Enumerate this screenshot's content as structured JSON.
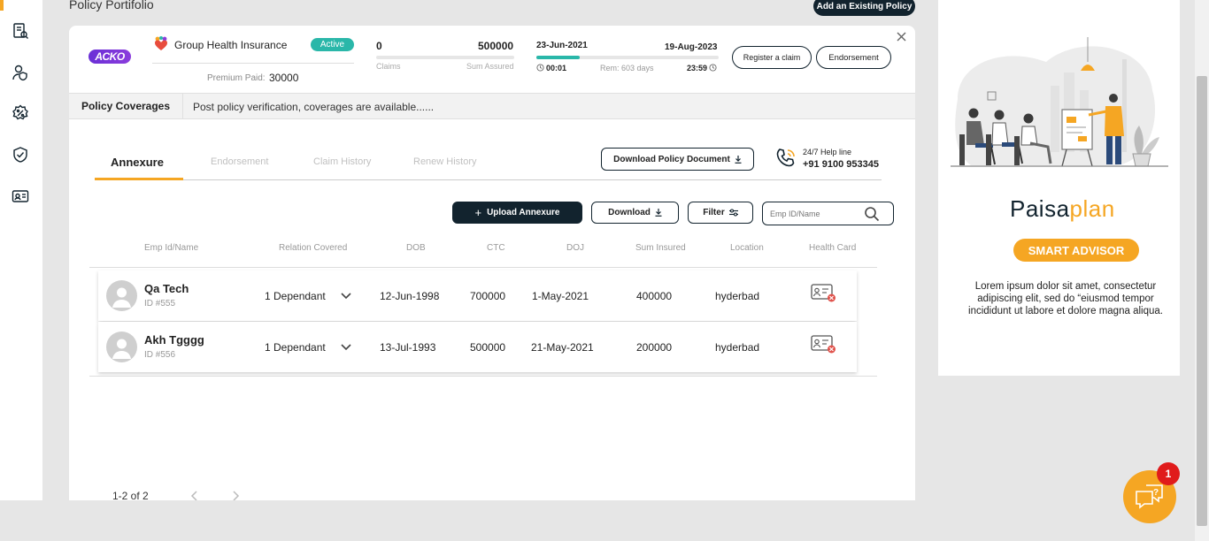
{
  "page": {
    "title": "Policy Portifolio",
    "add_policy_label": "Add an Existing Policy"
  },
  "sidebar": {
    "items": [
      {
        "name": "policies-icon"
      },
      {
        "name": "user-shield-icon"
      },
      {
        "name": "discount-icon"
      },
      {
        "name": "shield-check-icon"
      },
      {
        "name": "id-card-icon"
      }
    ]
  },
  "policy": {
    "insurer_logo": "ACKO",
    "name": "Group Health Insurance",
    "status": "Active",
    "premium_label": "Premium Paid:",
    "premium_value": "30000",
    "claims_value": "0",
    "claims_label": "Claims",
    "sum_assured_value": "500000",
    "sum_assured_label": "Sum Assured",
    "start_date": "23-Jun-2021",
    "end_date": "19-Aug-2023",
    "start_time": "00:01",
    "end_time": "23:59",
    "remaining": "Rem: 603 days",
    "elapsed_fraction": 0.24,
    "register_claim_label": "Register a claim",
    "endorsement_label": "Endorsement"
  },
  "coverage": {
    "label": "Policy Coverages",
    "message": "Post policy verification, coverages are available......"
  },
  "tabs": [
    {
      "label": "Annexure",
      "active": true
    },
    {
      "label": "Endorsement",
      "active": false
    },
    {
      "label": "Claim History",
      "active": false
    },
    {
      "label": "Renew History",
      "active": false
    }
  ],
  "download_doc_label": "Download Policy Document",
  "helpline": {
    "title": "24/7 Help line",
    "number": "+91 9100 953345"
  },
  "toolbar": {
    "upload_label": "Upload Annexure",
    "download_label": "Download",
    "filter_label": "Filter",
    "search_placeholder": "Emp ID/Name"
  },
  "table": {
    "columns": [
      "Emp Id/Name",
      "Relation Covered",
      "DOB",
      "CTC",
      "DOJ",
      "Sum Insured",
      "Location",
      "Health Card"
    ],
    "rows": [
      {
        "name": "Qa Tech",
        "id": "ID #555",
        "relation": "1 Dependant",
        "dob": "12-Jun-1998",
        "ctc": "700000",
        "doj": "1-May-2021",
        "sum_insured": "400000",
        "location": "hyderbad"
      },
      {
        "name": "Akh Tgggg",
        "id": "ID #556",
        "relation": "1 Dependant",
        "dob": "13-Jul-1993",
        "ctc": "500000",
        "doj": "21-May-2021",
        "sum_insured": "200000",
        "location": "hyderbad"
      }
    ]
  },
  "pagination": {
    "label": "1-2 of 2"
  },
  "ad": {
    "brand_part1": "Paisa",
    "brand_part2": "plan",
    "badge": "SMART ADVISOR",
    "text": "Lorem ipsum dolor sit amet, consectetur adipiscing elit, sed do “eiusmod tempor incididunt ut labore et dolore magna aliqua."
  },
  "chat": {
    "badge": "1"
  },
  "colors": {
    "accent": "#f5a623",
    "dark": "#12232e",
    "teal": "#2ab7a9",
    "danger": "#e01b1b"
  }
}
